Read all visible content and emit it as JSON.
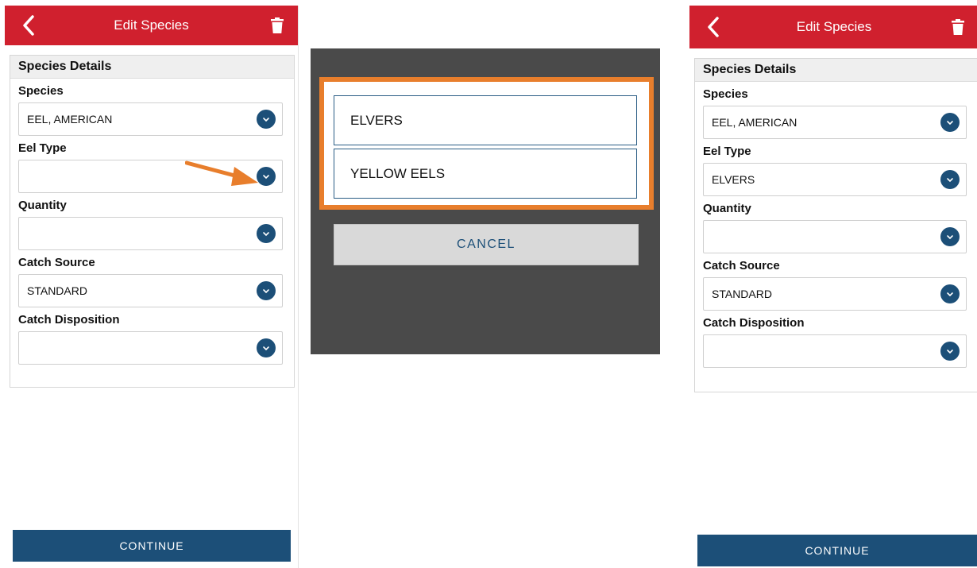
{
  "left_screen": {
    "header": {
      "title": "Edit Species"
    },
    "section_title": "Species Details",
    "fields": [
      {
        "label": "Species",
        "value": "EEL, AMERICAN"
      },
      {
        "label": "Eel Type",
        "value": ""
      },
      {
        "label": "Quantity",
        "value": ""
      },
      {
        "label": "Catch Source",
        "value": "STANDARD"
      },
      {
        "label": "Catch Disposition",
        "value": ""
      }
    ],
    "continue_label": "CONTINUE"
  },
  "picker": {
    "options": [
      "ELVERS",
      "YELLOW EELS"
    ],
    "cancel_label": "CANCEL"
  },
  "right_screen": {
    "header": {
      "title": "Edit Species"
    },
    "section_title": "Species Details",
    "fields": [
      {
        "label": "Species",
        "value": "EEL, AMERICAN"
      },
      {
        "label": "Eel Type",
        "value": "ELVERS"
      },
      {
        "label": "Quantity",
        "value": ""
      },
      {
        "label": "Catch Source",
        "value": "STANDARD"
      },
      {
        "label": "Catch Disposition",
        "value": ""
      }
    ],
    "continue_label": "CONTINUE"
  },
  "icons": {
    "back": "chevron-left-icon",
    "trash": "trash-icon",
    "dropdown": "chevron-down-icon",
    "annotation": "arrow-icon"
  },
  "colors": {
    "header_red": "#d0202e",
    "primary_blue": "#1c4f78",
    "highlight_orange": "#e87e2c",
    "modal_backdrop": "#4a4a4a"
  }
}
